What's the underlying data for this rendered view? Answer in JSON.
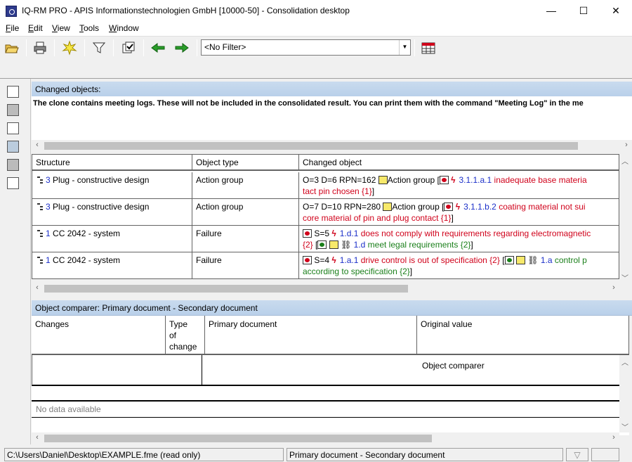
{
  "window": {
    "title": "IQ-RM PRO - APIS Informationstechnologien GmbH [10000-50] - Consolidation desktop",
    "minimize_label": "—",
    "maximize_label": "☐",
    "close_label": "✕"
  },
  "menu": [
    {
      "label": "File",
      "accel": "F",
      "rest": "ile"
    },
    {
      "label": "Edit",
      "accel": "E",
      "rest": "dit"
    },
    {
      "label": "View",
      "accel": "V",
      "rest": "iew"
    },
    {
      "label": "Tools",
      "accel": "T",
      "rest": "ools"
    },
    {
      "label": "Window",
      "accel": "W",
      "rest": "indow"
    }
  ],
  "toolbar": {
    "filter_value": "<No Filter>"
  },
  "changed_objects": {
    "header": "Changed objects:",
    "message": "The clone contains meeting logs. These will not be included in the consolidated result. You can print them with the command \"Meeting Log\" in the me"
  },
  "grid": {
    "columns": [
      "Structure",
      "Object type",
      "Changed object"
    ],
    "rows": [
      {
        "structure_num": "3",
        "structure_text": " Plug - constructive design",
        "object_type": "Action group",
        "line1_prefix": "O=3 D=6 RPN=162 ",
        "line1_group": "Action group [",
        "line1_id": "3.1.1.a.1",
        "line1_text": " inadequate base materia",
        "line2_text": "tact pin chosen  {1}",
        "line2_close": "]"
      },
      {
        "structure_num": "3",
        "structure_text": " Plug - constructive design",
        "object_type": "Action group",
        "line1_prefix": "O=7 D=10 RPN=280 ",
        "line1_group": "Action group [",
        "line1_id": "3.1.1.b.2",
        "line1_text": " coating material not sui",
        "line2_text": "core material of pin and plug contact {1}",
        "line2_close": "]"
      },
      {
        "structure_num": "1",
        "structure_text": " CC 2042 - system",
        "object_type": "Failure",
        "line1_prefix": "S=5 ",
        "line1_id": "1.d.1",
        "line1_text": " does not comply with requirements regarding electromagnetic",
        "line2_ref": "{2}",
        "line2_open": " [",
        "line2_id": "1.d",
        "line2_text": " meet legal requirements {2}",
        "line2_close": "]"
      },
      {
        "structure_num": "1",
        "structure_text": " CC 2042 - system",
        "object_type": "Failure",
        "line1_prefix": "S=4 ",
        "line1_id": "1.a.1",
        "line1_text": " drive control is out of specification {2}",
        "line1_open": " [",
        "line1_id2": "1.a",
        "line1_text2": " control p",
        "line2_text": "according to specification {2}",
        "line2_close": "]"
      }
    ]
  },
  "comparer": {
    "header": "Object comparer: Primary document - Secondary document",
    "columns": [
      "Changes",
      "Type of change",
      "Primary document",
      "Original value"
    ],
    "type_col_lines": [
      "Type",
      "of",
      "change"
    ],
    "inner_label": "Object comparer",
    "empty_text": "No data available"
  },
  "statusbar": {
    "file": "C:\\Users\\Daniel\\Desktop\\EXAMPLE.fme (read only)",
    "docs": "Primary document - Secondary document"
  }
}
